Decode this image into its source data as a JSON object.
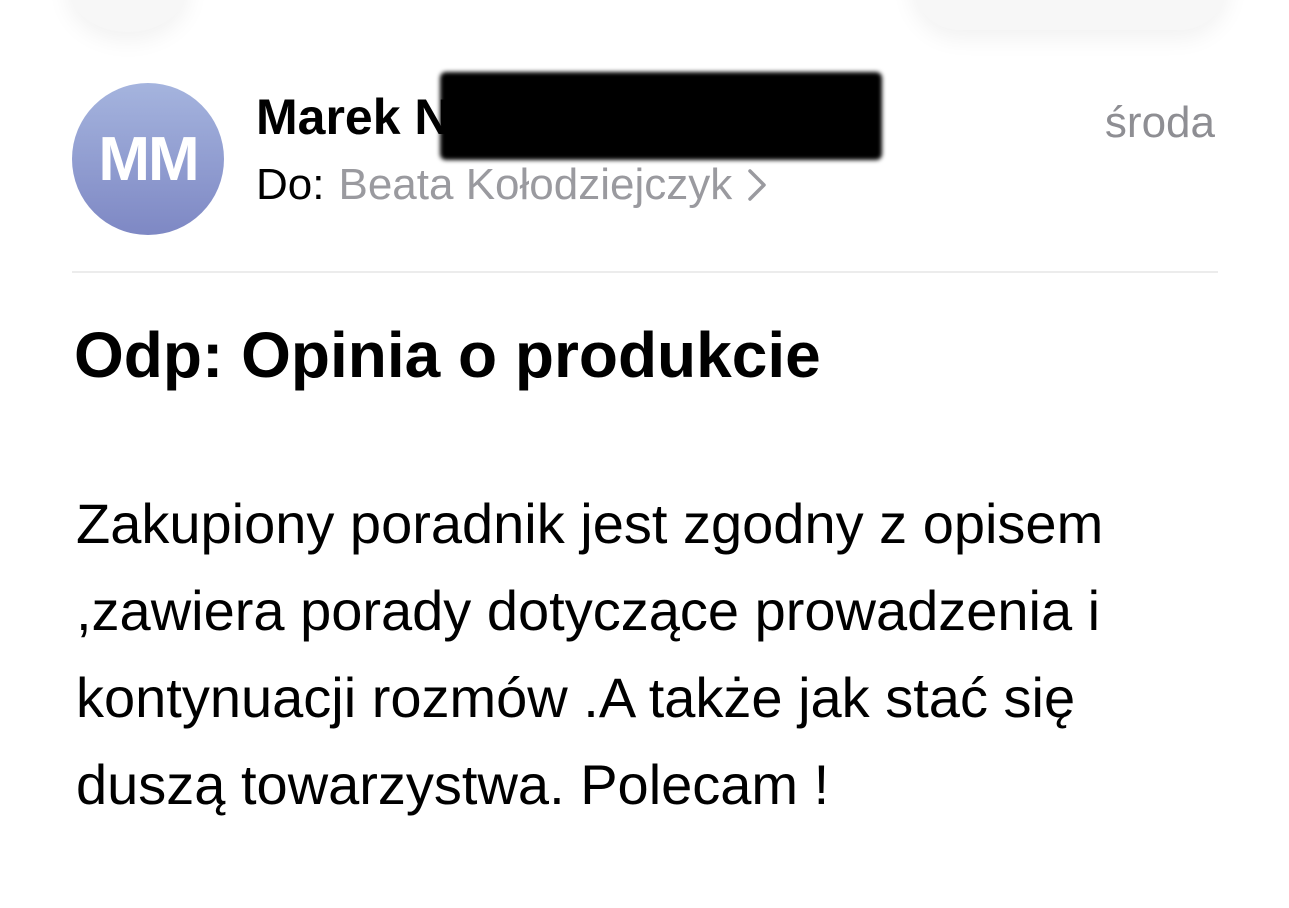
{
  "header": {
    "avatar_initials": "MM",
    "sender_name": "Marek N",
    "date": "środa",
    "to_label": "Do:",
    "recipient": "Beata Kołodziejczyk",
    "chevron_icon": "chevron-right-icon"
  },
  "message": {
    "subject": "Odp: Opinia o produkcie",
    "body_lines": [
      "Zakupiony poradnik jest zgodny z opisem",
      ",zawiera porady dotyczące prowadzenia i",
      "kontynuacji rozmów .A także jak stać się",
      "duszą towarzystwa.  Polecam !"
    ]
  },
  "colors": {
    "avatar_gradient_top": "#a5b4de",
    "avatar_gradient_bottom": "#7e88c4",
    "secondary_text": "#8e8e93",
    "divider": "#ececec"
  }
}
